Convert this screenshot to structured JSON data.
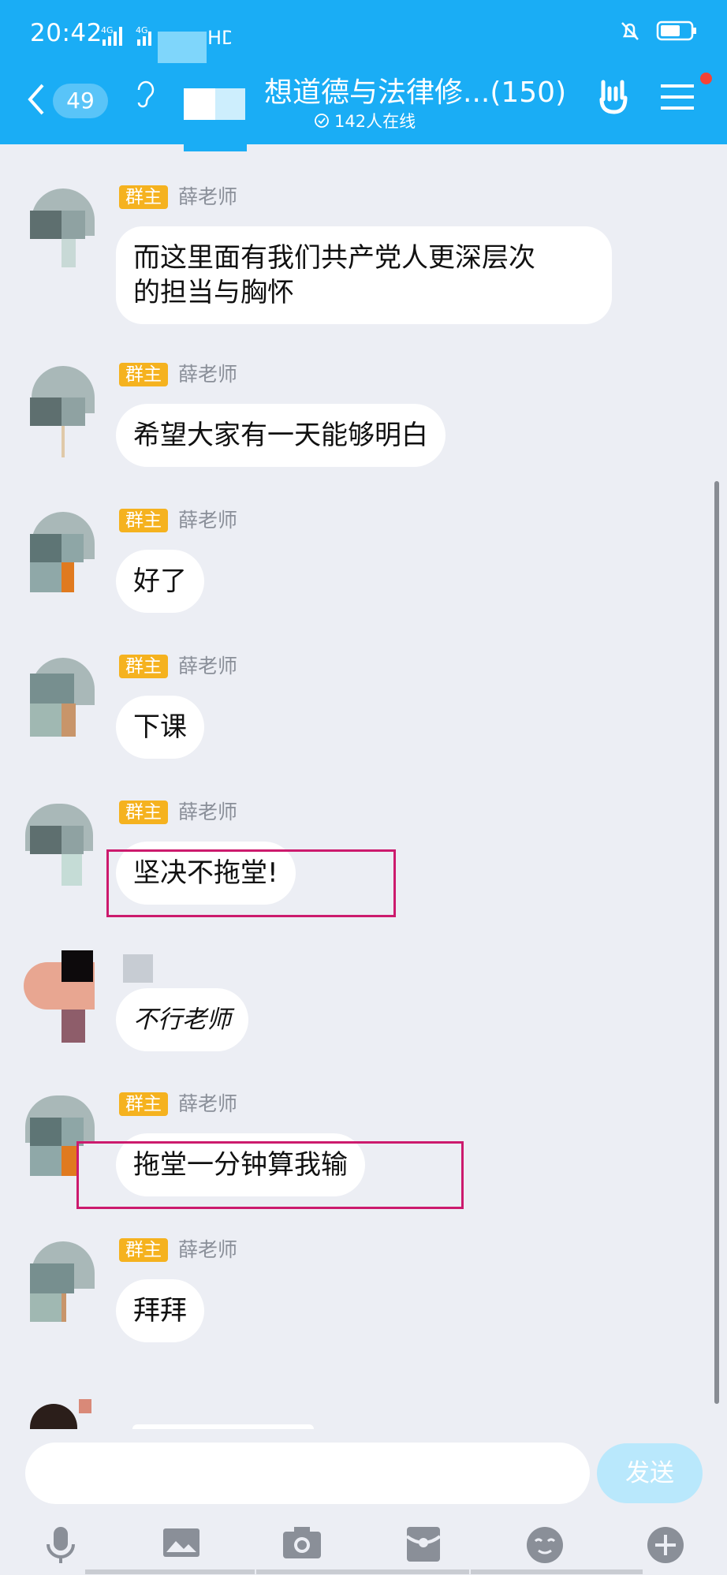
{
  "status_bar": {
    "time": "20:42",
    "network": "4G 4G HD"
  },
  "header": {
    "unread_count": "49",
    "title": "想道德与法律修...(150)",
    "online": "142人在线"
  },
  "messages": [
    {
      "tag": "群主",
      "sender": "薛老师",
      "text_line1": "而这里面有我们共产党人更深层次",
      "text_line2": "的担当与胸怀"
    },
    {
      "tag": "群主",
      "sender": "薛老师",
      "text": "希望大家有一天能够明白"
    },
    {
      "tag": "群主",
      "sender": "薛老师",
      "text": "好了"
    },
    {
      "tag": "群主",
      "sender": "薛老师",
      "text": "下课"
    },
    {
      "tag": "群主",
      "sender": "薛老师",
      "text": "坚决不拖堂!"
    },
    {
      "text": "不行老师"
    },
    {
      "tag": "群主",
      "sender": "薛老师",
      "text": "拖堂一分钟算我输"
    },
    {
      "tag": "群主",
      "sender": "薛老师",
      "text": "拜拜"
    }
  ],
  "input": {
    "send_label": "发送"
  },
  "toolbar_icons": [
    "microphone-icon",
    "image-icon",
    "camera-icon",
    "red-packet-icon",
    "emoji-icon",
    "plus-icon"
  ],
  "colors": {
    "header": "#1aadf5",
    "owner_tag": "#f5b21f",
    "highlight_box": "#cc1a6d",
    "send_button": "#b9e8fc"
  }
}
